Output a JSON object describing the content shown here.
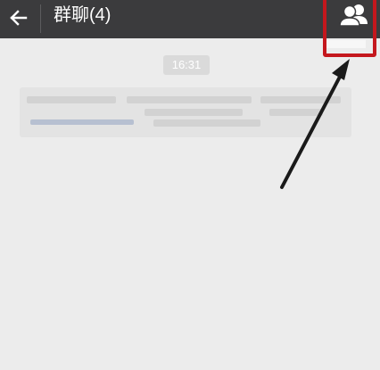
{
  "header": {
    "title": "群聊(4)",
    "back_icon": "arrow-left-icon",
    "group_icon": "group-members-icon"
  },
  "chat": {
    "timestamp": "16:31"
  },
  "annotation": {
    "highlight_color": "#c4171d",
    "arrow_color": "#1a1a1a"
  },
  "colors": {
    "topbar": "#3b3b3d",
    "background": "#ececec"
  }
}
